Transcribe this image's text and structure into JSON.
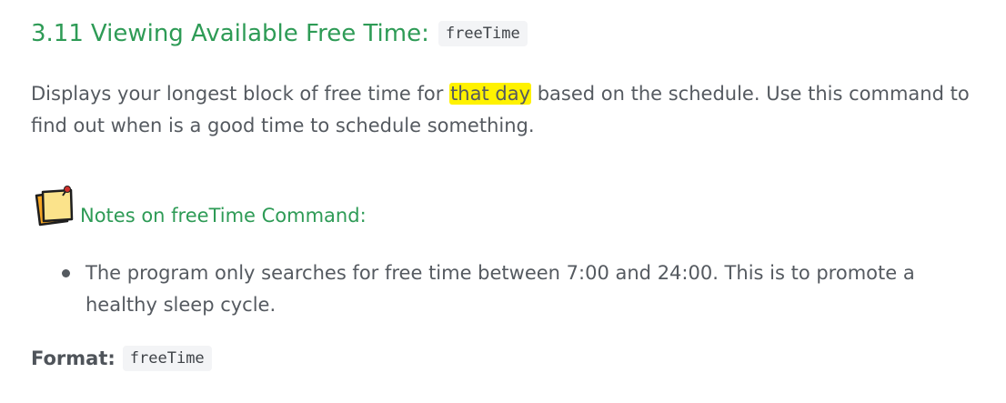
{
  "section": {
    "number": "3.11",
    "title": "Viewing Available Free Time:",
    "command": "freeTime"
  },
  "description": {
    "before": "Displays your longest block of free time for ",
    "highlight": "that day",
    "after": " based on the schedule. Use this command to find out when is a good time to schedule something."
  },
  "note": {
    "icon": "sticky-note-icon",
    "title": "Notes on freeTime Command:",
    "items": [
      "The program only searches for free time between 7:00 and 24:00. This is to promote a healthy sleep cycle."
    ]
  },
  "format": {
    "label": "Format:",
    "command": "freeTime"
  },
  "colors": {
    "heading": "#2e9b56",
    "highlight": "#fff200",
    "text": "#555a60",
    "code_bg": "#f3f4f6"
  }
}
